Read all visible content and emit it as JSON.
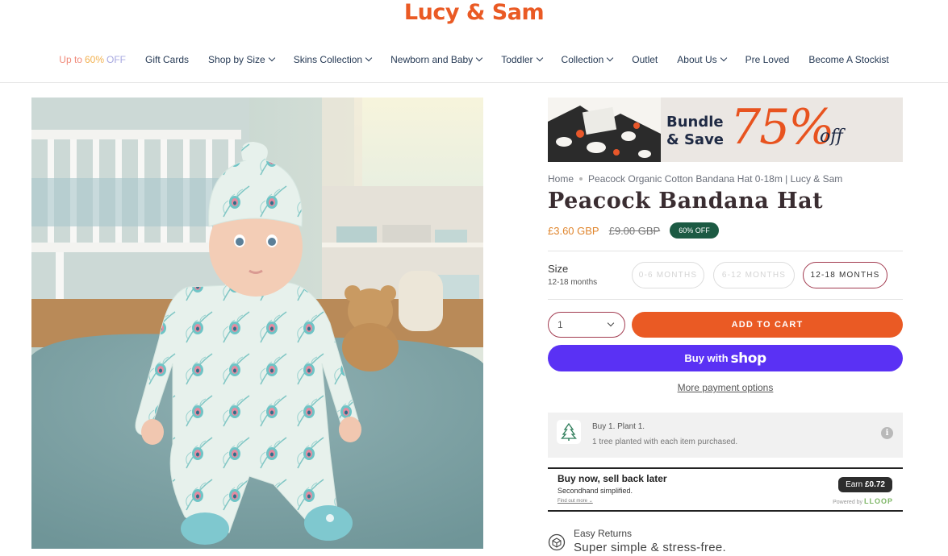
{
  "brand": {
    "logo_text": "Lucy & Sam"
  },
  "nav": {
    "sale_parts": [
      "Up to ",
      "60% ",
      "OFF"
    ],
    "items": [
      {
        "label": "Gift Cards",
        "has_menu": false
      },
      {
        "label": "Shop by Size",
        "has_menu": true
      },
      {
        "label": "Skins Collection",
        "has_menu": true
      },
      {
        "label": "Newborn and Baby",
        "has_menu": true
      },
      {
        "label": "Toddler",
        "has_menu": true
      },
      {
        "label": "Collection",
        "has_menu": true
      },
      {
        "label": "Outlet",
        "has_menu": false
      },
      {
        "label": "About Us",
        "has_menu": true
      },
      {
        "label": "Pre Loved",
        "has_menu": false
      },
      {
        "label": "Become A Stockist",
        "has_menu": false
      }
    ]
  },
  "promo_banner": {
    "line1": "Bundle",
    "line2": "& Save",
    "percent": "75%",
    "off": "off"
  },
  "breadcrumb": {
    "home": "Home",
    "current": "Peacock Organic Cotton Bandana Hat 0-18m | Lucy & Sam"
  },
  "product": {
    "title": "Peacock Bandana Hat",
    "price_sale": "£3.60 GBP",
    "price_original": "£9.00 GBP",
    "discount_badge": "60% OFF"
  },
  "size": {
    "label": "Size",
    "selected_value": "12-18 months",
    "options": [
      {
        "label": "0-6 MONTHS",
        "available": false
      },
      {
        "label": "6-12 MONTHS",
        "available": false
      },
      {
        "label": "12-18 MONTHS",
        "available": true,
        "selected": true
      }
    ]
  },
  "purchase": {
    "quantity": "1",
    "add_to_cart": "ADD TO CART",
    "shop_pay_prefix": "Buy with",
    "shop_pay_brand": "shop",
    "more_payment": "More payment options"
  },
  "tree_offer": {
    "title": "Buy 1. Plant 1.",
    "subtitle": "1 tree planted with each item purchased.",
    "info_icon": "i"
  },
  "loop": {
    "heading": "Buy now, sell back later",
    "subheading": "Secondhand simplified.",
    "find_out": "Find out more",
    "earn_prefix": "Earn",
    "earn_amount": "£0.72",
    "powered_by": "Powered by",
    "powered_brand": "LLOOP"
  },
  "returns": {
    "title": "Easy Returns",
    "subtitle": "Super simple & stress-free."
  },
  "colors": {
    "brand_orange": "#ea5a24",
    "shop_pay_purple": "#5a31f4",
    "badge_green": "#1c5a43",
    "selected_size_border": "#a23b50"
  },
  "icons": [
    "chevron-down-icon",
    "tree-icon",
    "info-icon",
    "returns-icon"
  ]
}
